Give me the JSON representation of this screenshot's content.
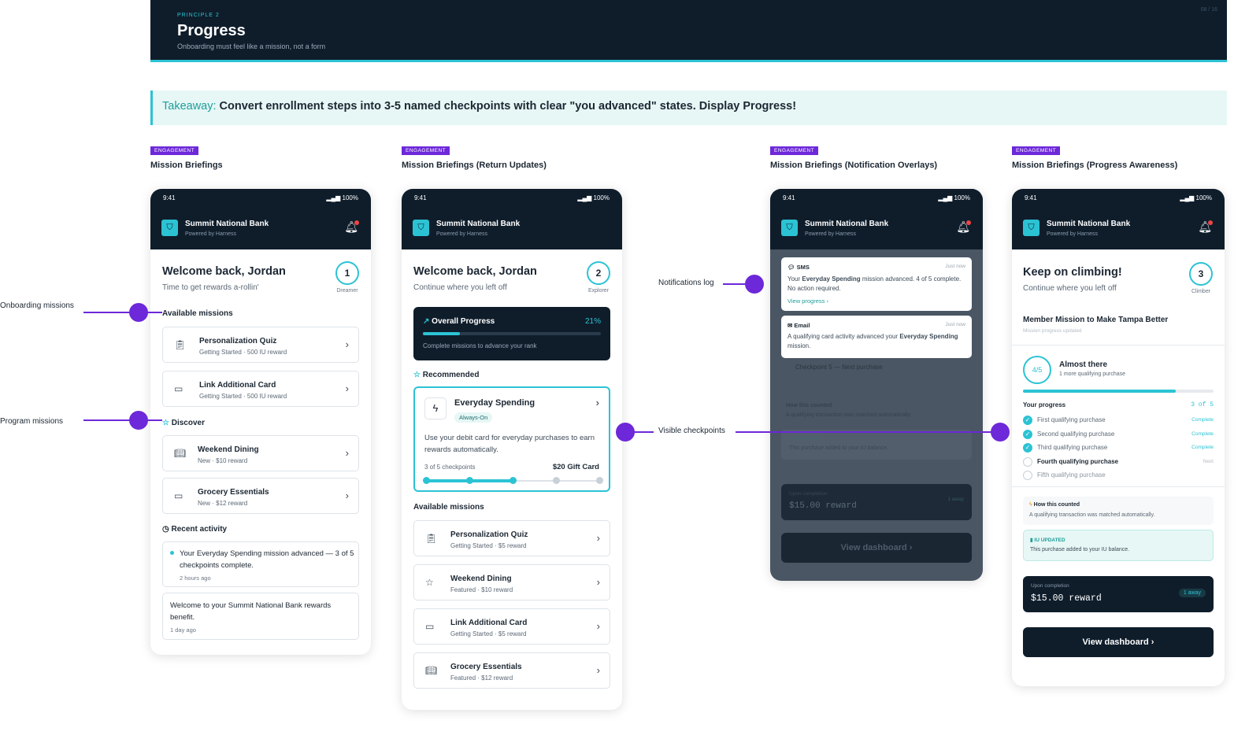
{
  "header": {
    "kicker": "PRINCIPLE 2",
    "title": "Progress",
    "subtitle": "Onboarding must feel like a mission, not a form",
    "page": "08 / 16"
  },
  "takeaway": {
    "label": "Takeaway:",
    "text": "Convert enrollment steps into 3-5 named checkpoints with clear \"you advanced\" states. Display Progress!"
  },
  "callouts": {
    "onboarding": "Onboarding missions",
    "program": "Program missions",
    "notifications": "Notifications log",
    "checkpoints": "Visible checkpoints"
  },
  "common": {
    "time": "9:41",
    "signal": "100%",
    "bank": "Summit National Bank",
    "powered": "Powered by Harness",
    "tag": "ENGAGEMENT"
  },
  "screen1": {
    "title": "Mission Briefings",
    "welcome": "Welcome back, Jordan",
    "sub": "Time to get rewards a-rollin'",
    "rank_num": "1",
    "rank": "Dreamer",
    "available": "Available missions",
    "m1_title": "Personalization Quiz",
    "m1_sub": "Getting Started · 500 IU reward",
    "m2_title": "Link Additional Card",
    "m2_sub": "Getting Started · 500 IU reward",
    "discover": "Discover",
    "d1_title": "Weekend Dining",
    "d1_sub": "New · $10 reward",
    "d2_title": "Grocery Essentials",
    "d2_sub": "New · $12 reward",
    "recent": "Recent activity",
    "r1": "Your Everyday Spending mission advanced — 3 of 5 checkpoints complete.",
    "r1_time": "2 hours ago",
    "r2": "Welcome to your Summit National Bank rewards benefit.",
    "r2_time": "1 day ago"
  },
  "screen2": {
    "title": "Mission Briefings (Return Updates)",
    "welcome": "Welcome back, Jordan",
    "sub": "Continue where you left off",
    "rank_num": "2",
    "rank": "Explorer",
    "overall": "Overall Progress",
    "overall_pct": "21%",
    "overall_value": 0.21,
    "overall_note": "Complete missions to advance your rank",
    "recommended": "Recommended",
    "rec_title": "Everyday Spending",
    "rec_badge": "Always-On",
    "rec_desc": "Use your debit card for everyday purchases to earn rewards automatically.",
    "rec_checks": "3 of 5 checkpoints",
    "rec_reward": "$20 Gift Card",
    "rec_done": 3,
    "rec_total": 5,
    "available": "Available missions",
    "m1_title": "Personalization Quiz",
    "m1_sub": "Getting Started · $5 reward",
    "m2_title": "Weekend Dining",
    "m2_sub": "Featured · $10 reward",
    "m3_title": "Link Additional Card",
    "m3_sub": "Getting Started · $5 reward",
    "m4_title": "Grocery Essentials",
    "m4_sub": "Featured · $12 reward"
  },
  "screen3": {
    "title": "Mission Briefings (Notification Overlays)",
    "sms_label": "SMS",
    "sms_time": "Just now",
    "sms_pre": "Your ",
    "sms_bold": "Everyday Spending",
    "sms_post": " mission advanced. 4 of 5 complete. No action required.",
    "sms_link": "View progress ›",
    "email_label": "Email",
    "email_time": "Just now",
    "email_pre": "A qualifying card activity advanced your ",
    "email_bold": "Everyday Spending",
    "email_post": " mission.",
    "bg_checkpoint": "Checkpoint 5 — Next purchase",
    "bg_how": "How this counted",
    "bg_how_sub": "A qualifying transaction was matched automatically.",
    "bg_iu": "IU UPDATED",
    "bg_iu_sub": "This purchase added to your IU balance.",
    "bg_upon": "Upon completion",
    "bg_reward": "$15.00 reward",
    "bg_away": "1 away",
    "bg_btn": "View dashboard"
  },
  "screen4": {
    "title": "Mission Briefings (Progress Awareness)",
    "heading": "Keep on climbing!",
    "sub": "Continue where you left off",
    "rank_num": "3",
    "rank": "Climber",
    "mission": "Member Mission to Make Tampa Better",
    "mission_sub": "Mission progress updated",
    "ring": "4/5",
    "almost": "Almost there",
    "almost_sub": "1 more qualifying purchase",
    "progress_value": 0.8,
    "your_progress": "Your progress",
    "count": "3 of 5",
    "steps": [
      {
        "label": "First qualifying purchase",
        "status": "Complete"
      },
      {
        "label": "Second qualifying purchase",
        "status": "Complete"
      },
      {
        "label": "Third qualifying purchase",
        "status": "Complete"
      },
      {
        "label": "Fourth qualifying purchase",
        "status": "Next"
      },
      {
        "label": "Fifth qualifying purchase",
        "status": ""
      }
    ],
    "how": "How this counted",
    "how_sub": "A qualifying transaction was matched automatically.",
    "iu": "IU UPDATED",
    "iu_sub": "This purchase added to your IU balance.",
    "upon": "Upon completion",
    "reward": "$15.00 reward",
    "away": "1 away",
    "btn": "View dashboard"
  },
  "colors": {
    "navy": "#0f1d2b",
    "teal": "#2bc3d4",
    "purple": "#6d28d9"
  }
}
